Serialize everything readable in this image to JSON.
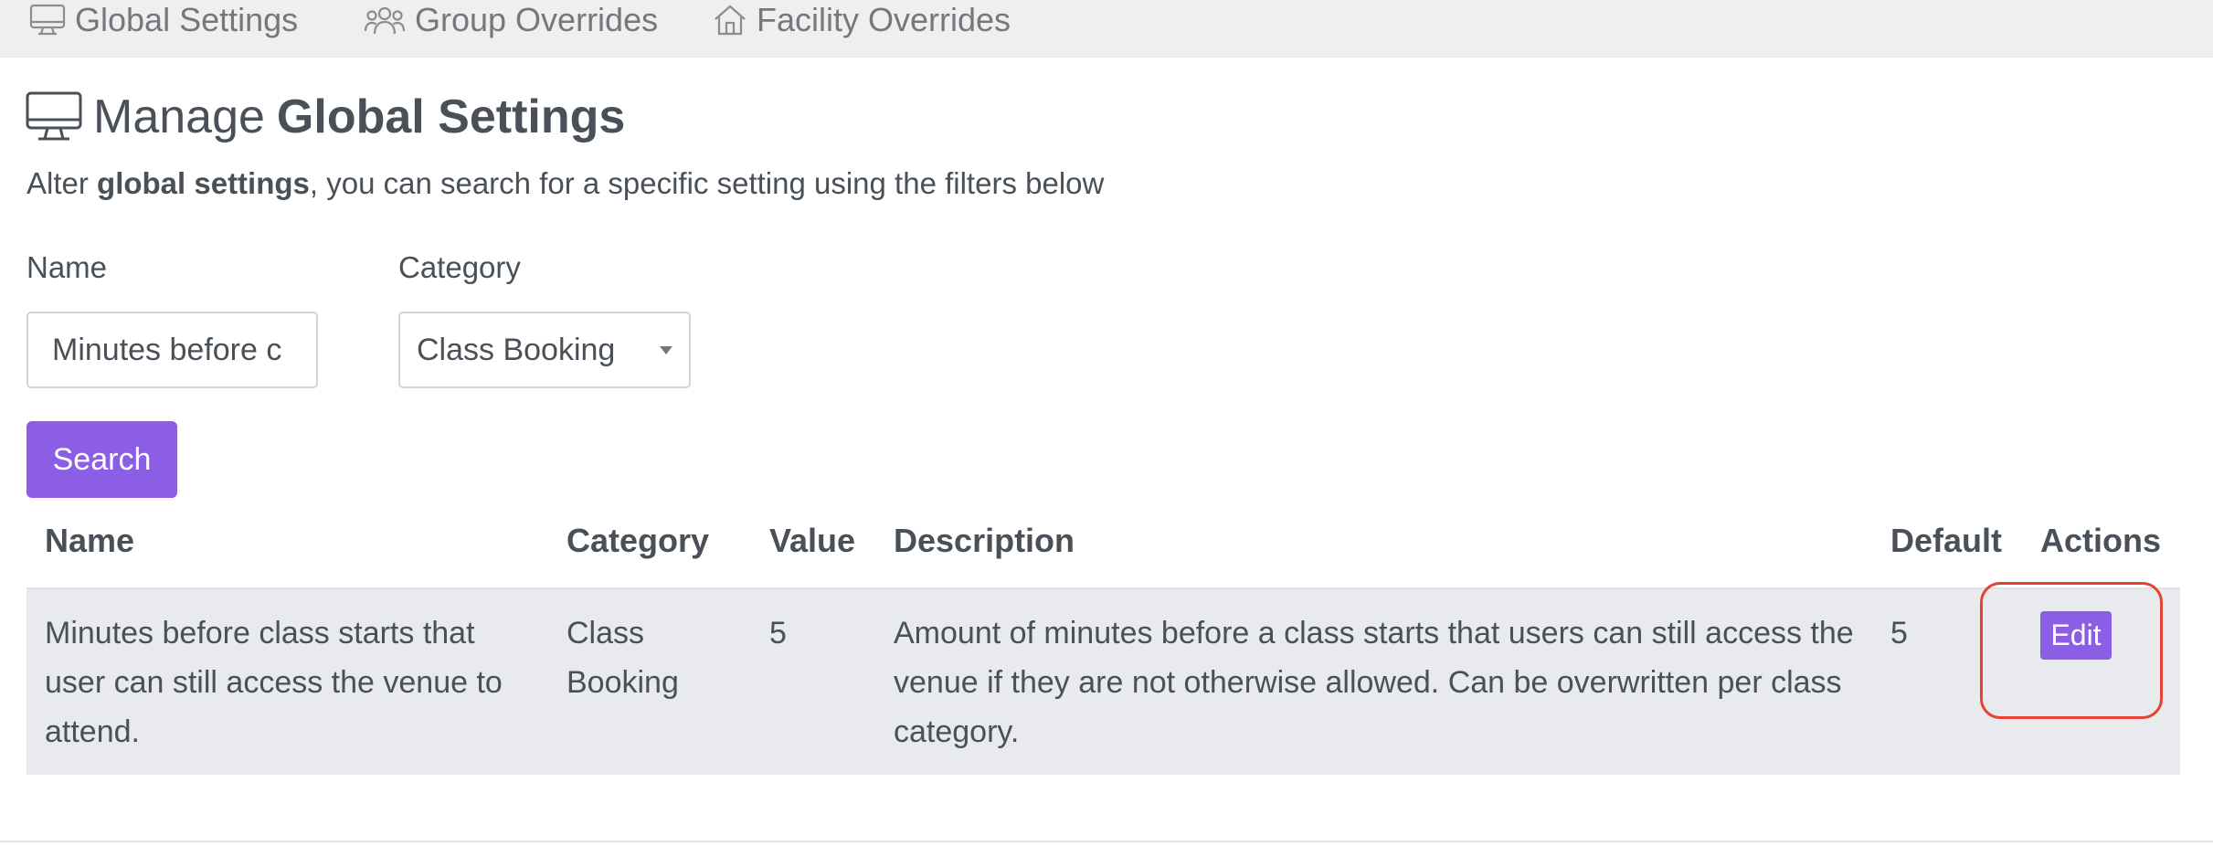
{
  "nav": {
    "tabs": [
      {
        "label": "Global Settings",
        "icon": "monitor-icon"
      },
      {
        "label": "Group Overrides",
        "icon": "users-icon"
      },
      {
        "label": "Facility Overrides",
        "icon": "home-icon"
      }
    ]
  },
  "header": {
    "title_prefix": "Manage",
    "title_strong": "Global Settings",
    "icon": "monitor-icon"
  },
  "subtitle": {
    "prefix": "Alter",
    "strong": "global settings",
    "suffix": ", you can search for a specific setting using the filters below"
  },
  "filters": {
    "name_label": "Name",
    "name_value": "Minutes before c",
    "category_label": "Category",
    "category_value": "Class Booking",
    "search_label": "Search"
  },
  "table": {
    "columns": [
      "Name",
      "Category",
      "Value",
      "Description",
      "Default",
      "Actions"
    ],
    "rows": [
      {
        "name": "Minutes before class starts that user can still access the venue to attend.",
        "category": "Class Booking",
        "value": "5",
        "description": "Amount of minutes before a class starts that users can still access the venue if they are not otherwise allowed. Can be overwritten per class category.",
        "default": "5",
        "action_label": "Edit"
      }
    ]
  },
  "colors": {
    "accent": "#8c5ee6",
    "highlight": "#e34234",
    "nav_bg": "#efefef",
    "row_bg": "#e9eaed",
    "text": "#495057"
  }
}
